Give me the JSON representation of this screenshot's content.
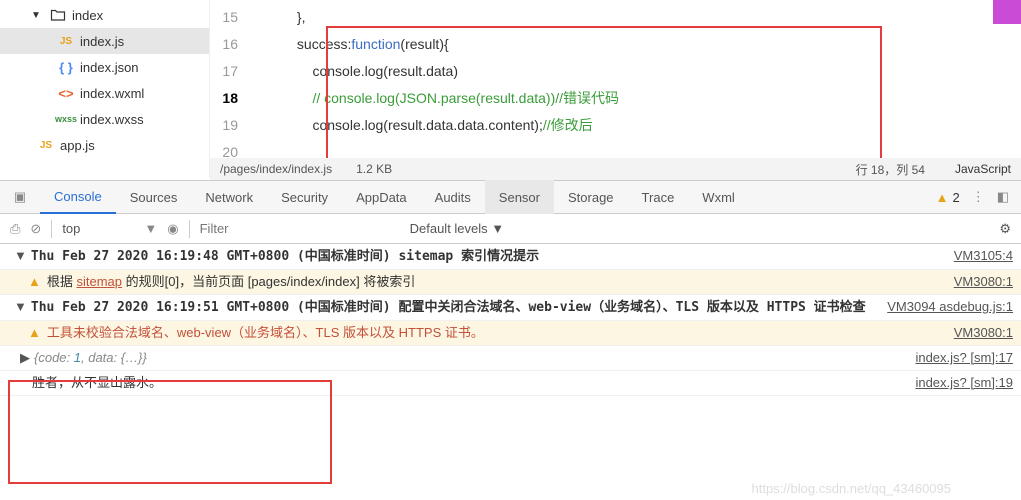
{
  "tree": {
    "root": "index",
    "items": [
      {
        "icon": "js",
        "label": "index.js"
      },
      {
        "icon": "json",
        "label": "index.json"
      },
      {
        "icon": "wxml",
        "label": "index.wxml"
      },
      {
        "icon": "wxss",
        "label": "index.wxss"
      }
    ],
    "app": "app.js"
  },
  "editor": {
    "lines": [
      "15",
      "16",
      "17",
      "18",
      "19",
      "20"
    ],
    "current_line": "18",
    "code": {
      "l15": "},",
      "l16a": "success:",
      "l16b": "function",
      "l16c": "(result){",
      "l17": "console.log(result.data)",
      "l18a": "// console.log(JSON.parse(result.data))",
      "l18b": "//错误代码",
      "l19a": "console.log(result.data.data.content);",
      "l19b": "//修改后",
      "l20": ""
    }
  },
  "status": {
    "path": "/pages/index/index.js",
    "size": "1.2 KB",
    "pos": "行 18，列 54",
    "lang": "JavaScript"
  },
  "devtools": {
    "tabs": [
      "Console",
      "Sources",
      "Network",
      "Security",
      "AppData",
      "Audits",
      "Sensor",
      "Storage",
      "Trace",
      "Wxml"
    ],
    "active": "Console",
    "warn_count": "2",
    "context": "top",
    "filter_placeholder": "Filter",
    "levels": "Default levels ▼"
  },
  "console": {
    "r1": {
      "caret": "▼",
      "text": "Thu Feb 27 2020 16:19:48 GMT+0800 (中国标准时间) sitemap 索引情况提示",
      "src": "VM3105:4"
    },
    "r2": {
      "pre": "根据 ",
      "link": "sitemap",
      "mid": " 的规则[0]，当前页面 [pages/index/index] 将被索引",
      "src": "VM3080:1"
    },
    "r3": {
      "caret": "▼",
      "text": "Thu Feb 27 2020 16:19:51 GMT+0800 (中国标准时间) 配置中关闭合法域名、web-view（业务域名）、TLS 版本以及 HTTPS 证书检查",
      "src": "VM3094 asdebug.js:1"
    },
    "r4": {
      "text": "工具未校验合法域名、web-view（业务域名）、TLS 版本以及 HTTPS 证书。",
      "src": "VM3080:1"
    },
    "r5": {
      "caret": "▶",
      "obj": "{code: ",
      "key1": "1",
      "mid": ", data: ",
      "key2": "{…}",
      "end": "}",
      "src": "index.js? [sm]:17"
    },
    "r6": {
      "text": "胜者，从不显山露水。",
      "src": "index.js? [sm]:19"
    }
  },
  "watermark": "https://blog.csdn.net/qq_43460095"
}
